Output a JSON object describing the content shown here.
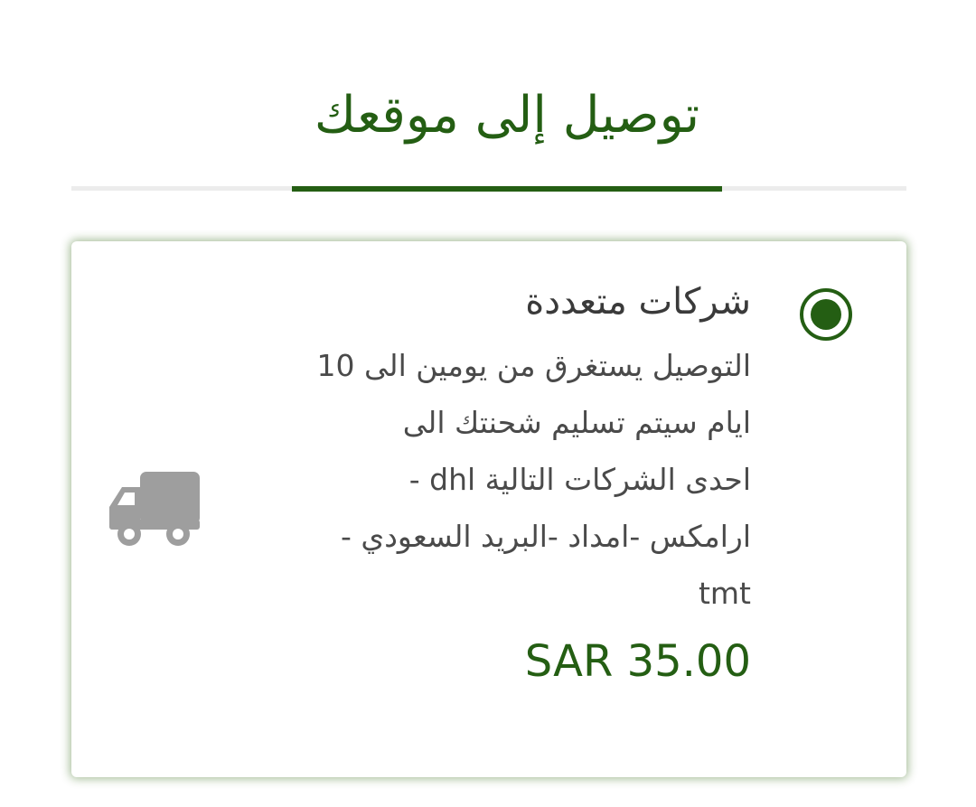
{
  "tab": {
    "title": "توصيل إلى موقعك"
  },
  "shipping_option": {
    "selected": true,
    "title": "شركات متعددة",
    "description": "التوصيل يستغرق من يومين الى 10\nايام سيتم تسليم شحنتك الى\nاحدى الشركات التالية dhl -\nارامكس -امداد -البريد السعودي -\ntmt",
    "price": "SAR 35.00",
    "icon": "truck-icon"
  },
  "colors": {
    "accent": "#245e13",
    "icon_gray": "#9e9e9e",
    "track": "#ececec"
  }
}
